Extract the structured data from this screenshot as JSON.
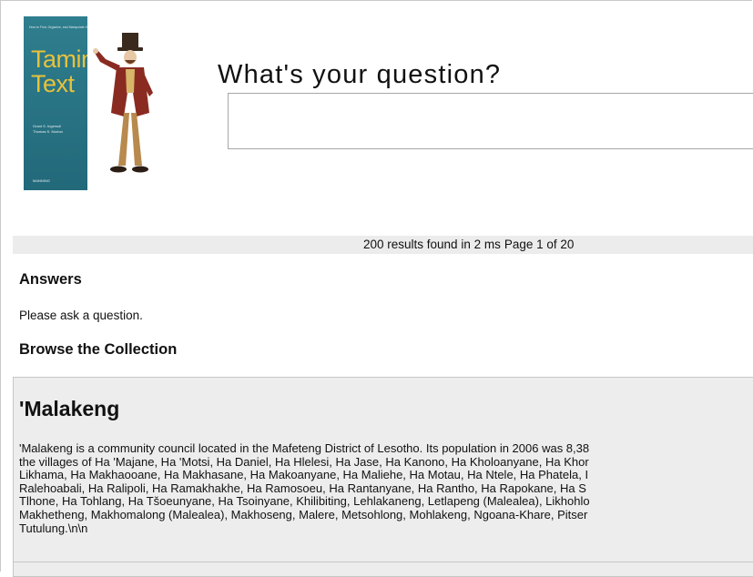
{
  "book_cover": {
    "tagline": "How to Find, Organize, and Manipulate It",
    "title_line1": "Taming",
    "title_line2": "Text",
    "author1": "Grant S. Ingersoll",
    "author2": "Thomas S. Morton",
    "publisher": "MANNING",
    "colors": {
      "background": "#2a7585",
      "title": "#e8c23a"
    }
  },
  "search": {
    "heading": "What's your question?",
    "input_value": "",
    "input_placeholder": ""
  },
  "results": {
    "summary": "200 results found in 2 ms",
    "page_info": "Page 1 of 20"
  },
  "answers": {
    "heading": "Answers",
    "message": "Please ask a question."
  },
  "browse": {
    "heading": "Browse the Collection",
    "documents": [
      {
        "title": "'Malakeng",
        "lines": [
          "'Malakeng is a community council located in the Mafeteng District of Lesotho. Its population in 2006 was 8,38",
          "the villages of Ha 'Majane, Ha 'Motsi, Ha Daniel, Ha Hlelesi, Ha Jase, Ha Kanono, Ha Kholoanyane, Ha Khor",
          "Likhama, Ha Makhaooane, Ha Makhasane, Ha Makoanyane, Ha Maliehe, Ha Motau, Ha Ntele, Ha Phatela, I",
          "Ralehoabali, Ha Ralipoli, Ha Ramakhakhe, Ha Ramosoeu, Ha Rantanyane, Ha Rantho, Ha Rapokane, Ha S",
          "Tlhone, Ha Tohlang, Ha Tšoeunyane, Ha Tsoinyane, Khilibiting, Lehlakaneng, Letlapeng (Malealea), Likhohlo",
          "Makhetheng, Makhomalong (Malealea), Makhoseng, Malere, Metsohlong, Mohlakeng, Ngoana-Khare, Pitser",
          "Tutulung.\\n\\n"
        ]
      }
    ]
  }
}
